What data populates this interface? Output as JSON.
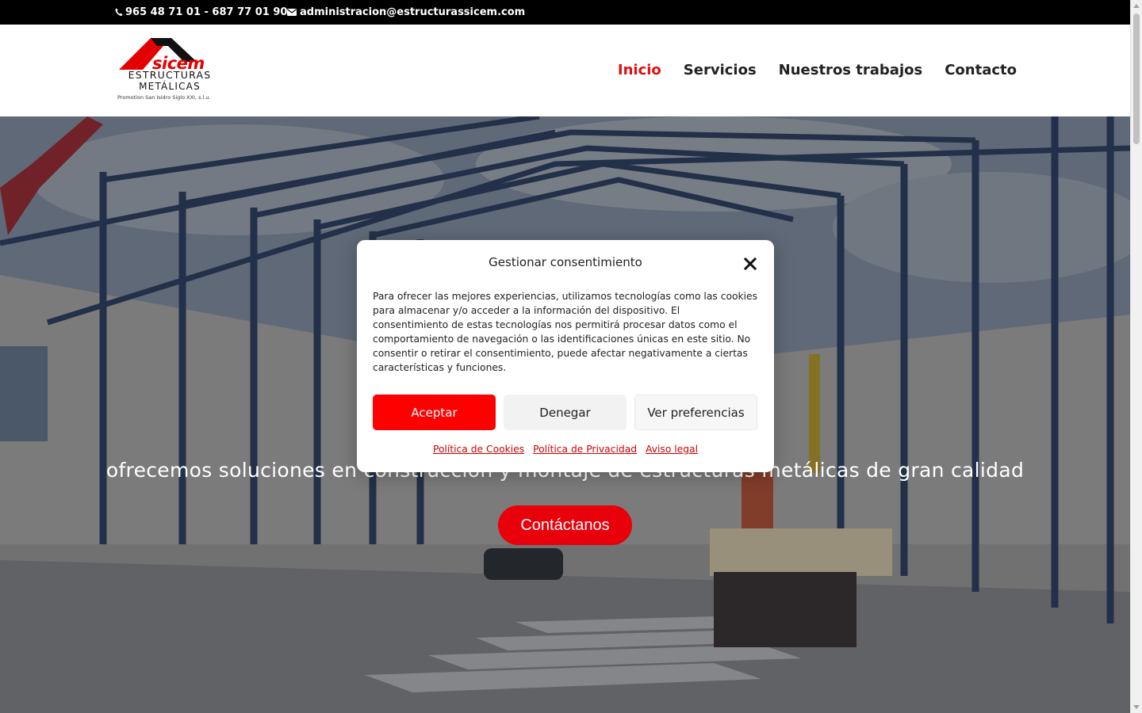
{
  "topbar": {
    "phone": "965 48 71 01 - 687 77 01 90",
    "email": "administracion@estructurassicem.com"
  },
  "logo": {
    "brand": "sicem",
    "line1": "ESTRUCTURAS",
    "line2": "METÁLICAS",
    "line3": "Promotion San Isidro Siglo XXI, s.l.u."
  },
  "nav": {
    "items": [
      {
        "label": "Inicio",
        "active": true
      },
      {
        "label": "Servicios",
        "active": false
      },
      {
        "label": "Nuestros trabajos",
        "active": false
      },
      {
        "label": "Contacto",
        "active": false
      }
    ]
  },
  "hero": {
    "subtitle": "ofrecemos soluciones en construcción y montaje de estructuras metálicas de gran calidad",
    "cta": "Contáctanos"
  },
  "consent": {
    "title": "Gestionar consentimiento",
    "body": "Para ofrecer las mejores experiencias, utilizamos tecnologías como las cookies para almacenar y/o acceder a la información del dispositivo. El consentimiento de estas tecnologías nos permitirá procesar datos como el comportamiento de navegación o las identificaciones únicas en este sitio. No consentir o retirar el consentimiento, puede afectar negativamente a ciertas características y funciones.",
    "accept": "Aceptar",
    "deny": "Denegar",
    "preferences": "Ver preferencias",
    "links": [
      "Política de Cookies",
      "Política de Privacidad",
      "Aviso legal"
    ]
  },
  "colors": {
    "accent": "#e8000b",
    "nav_active": "#e01010",
    "topbar_bg": "#000000"
  },
  "icons": {
    "phone": "phone-icon",
    "email": "envelope-icon",
    "close": "close-icon"
  }
}
